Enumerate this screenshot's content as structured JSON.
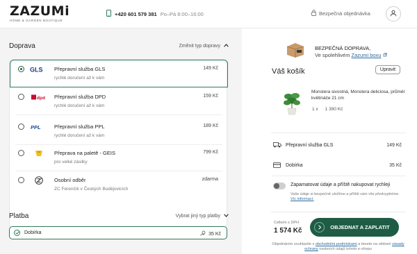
{
  "header": {
    "logo": "ZAZUMi",
    "logo_sub": "HOME & GARDEN BOUTIQUE",
    "phone": "+420 601 579 381",
    "hours": "Po–Pá 8:00–16:00",
    "secure_order": "Bezpečná objednávka",
    "icons": {
      "phone": "phone-icon",
      "secure": "lock-icon",
      "user": "user-icon"
    }
  },
  "shipping": {
    "title": "Doprava",
    "change_link": "Změnit typ dopravy",
    "options": [
      {
        "name": "Přepravní služba GLS",
        "sub": "rychlé doručení až k vám",
        "price": "149 Kč",
        "carrier": "GLS",
        "selected": true
      },
      {
        "name": "Přepravní služba DPD",
        "sub": "rychlé doručení až k vám",
        "price": "159 Kč",
        "carrier": "dpd",
        "selected": false
      },
      {
        "name": "Přepravní služba PPL",
        "sub": "rychlé doručení až k vám",
        "price": "189 Kč",
        "carrier": "PPL",
        "selected": false
      },
      {
        "name": "Přeprava na paletě - GEIS",
        "sub": "pro velké zásilky",
        "price": "799 Kč",
        "carrier": "geis",
        "selected": false
      },
      {
        "name": "Osobní odběr",
        "sub": "ZC Ferenčík v Českých Budějovicích",
        "price": "zdarma",
        "carrier": "zazumi",
        "selected": false
      }
    ]
  },
  "payment": {
    "title": "Platba",
    "change_link": "Vybrat jiný typ platby",
    "selected": {
      "name": "Dobírka",
      "price": "35 Kč"
    }
  },
  "promo": {
    "line1": "BEZPEČNÁ DOPRAVA,",
    "line2_prefix": "Ve spolehlivém",
    "line2_link": "Zazumi boxu"
  },
  "cart": {
    "title": "Váš košík",
    "edit_label": "Upravit",
    "product": {
      "name": "Monstera sivostná, Monstera deliciosa, průměr květináče 21 cm",
      "qty": "1 x",
      "price": "1 390 Kč"
    },
    "shipping_line": {
      "label": "Přepravní služba GLS",
      "value": "149 Kč"
    },
    "payment_line": {
      "label": "Dobírka",
      "value": "35 Kč"
    },
    "remember": "Zapamatovat údaje a příště nakupovat rychleji",
    "remember_sub": "Vaše údaje si bezpečně uložíme a příště vám vše předvyplníme.",
    "remember_link": "Víc informací.",
    "total_label": "Celkem s DPH",
    "total_value": "1 574 Kč",
    "pay_button": "OBJEDNAT A ZAPLATIT",
    "footer_prefix": "Objednáním souhlasíte s",
    "footer_link1": "obchodními podmínkami",
    "footer_mid": "a berete na vědomí",
    "footer_link2": "zásady ochrany",
    "footer_suffix": "osobních údajů tohoto e-shopu"
  },
  "colors": {
    "accent": "#1f5c46",
    "link": "#2e6a9e",
    "panel_bg": "#f4f4f4"
  }
}
